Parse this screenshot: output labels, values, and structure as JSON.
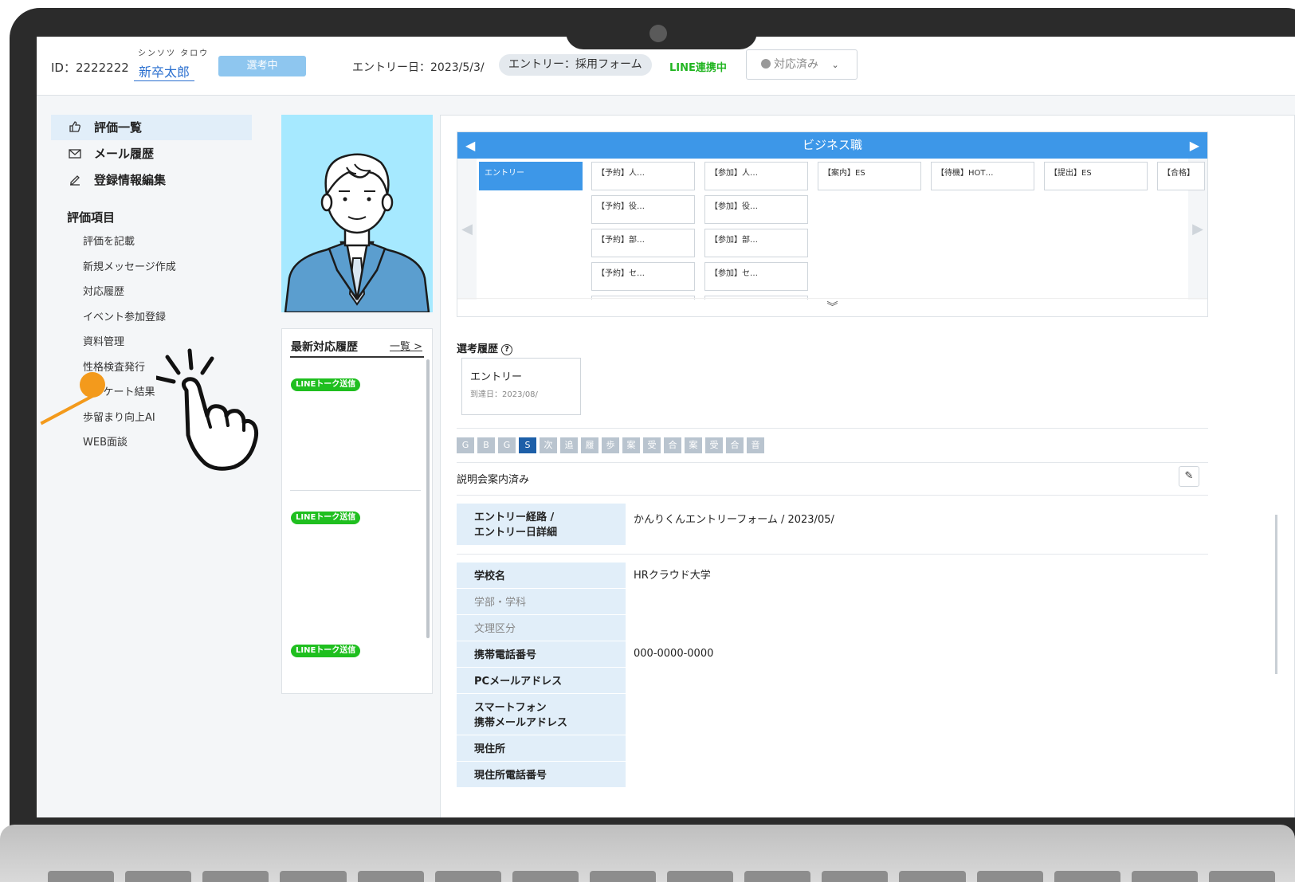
{
  "header": {
    "id_text": "ID：2222222",
    "kana": "シンソツ タロウ",
    "name": "新卒太郎",
    "status": "選考中",
    "entry_date": "エントリー日：2023/5/3/",
    "entry_route": "エントリー：採用フォーム",
    "line_status": "LINE連携中",
    "response_select": "対応済み"
  },
  "sidebar": {
    "nav": [
      {
        "label": "評価一覧",
        "icon": "thumbs-up-icon"
      },
      {
        "label": "メール履歴",
        "icon": "mail-icon"
      },
      {
        "label": "登録情報編集",
        "icon": "pencil-icon"
      }
    ],
    "section_title": "評価項目",
    "sub_items": [
      "評価を記載",
      "新規メッセージ作成",
      "対応履歴",
      "イベント参加登録",
      "資料管理",
      "性格検査発行",
      "アンケート結果",
      "歩留まり向上AI",
      "WEB面談"
    ]
  },
  "latest": {
    "title": "最新対応履歴",
    "link": "一覧 >",
    "badges": [
      "LINEトーク送信",
      "LINEトーク送信",
      "LINEトーク送信"
    ]
  },
  "pipeline": {
    "title": "ビジネス職",
    "row1": [
      "エントリー",
      "【予約】人…",
      "【参加】人…",
      "【案内】ES",
      "【待機】HOT…",
      "【提出】ES",
      "【合格】"
    ],
    "row2": [
      "【予約】役…",
      "【参加】役…"
    ],
    "row3": [
      "【予約】部…",
      "【参加】部…"
    ],
    "row4": [
      "【予約】セ…",
      "【参加】セ…"
    ]
  },
  "history": {
    "title": "選考履歴",
    "card_title": "エントリー",
    "card_date": "到達日：2023/08/"
  },
  "tags": [
    "G",
    "B",
    "G",
    "S",
    "次",
    "追",
    "履",
    "歩",
    "案",
    "受",
    "合",
    "案",
    "受",
    "合",
    "音"
  ],
  "status_note": "説明会案内済み",
  "fields": {
    "entry_label_1": "エントリー経路 /",
    "entry_label_2": "エントリー日詳細",
    "entry_value": "かんりくんエントリーフォーム / 2023/05/",
    "school_label": "学校名",
    "school_value": "HRクラウド大学",
    "faculty_label": "学部・学科",
    "course_label": "文理区分",
    "mobile_label": "携帯電話番号",
    "mobile_value": "000-0000-0000",
    "pc_mail_label": "PCメールアドレス",
    "sp_mail_label_1": "スマートフォン",
    "sp_mail_label_2": "携帯メールアドレス",
    "address_label": "現住所",
    "address_phone_label": "現住所電話番号"
  },
  "colors": {
    "accent": "#3d97e8",
    "line_green": "#1fbf1f",
    "pointer_orange": "#f39a1c",
    "photo_bg": "#a6e9ff"
  }
}
